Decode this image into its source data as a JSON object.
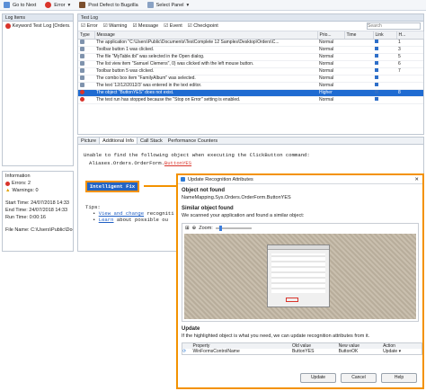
{
  "toolbar": {
    "items": [
      {
        "label": "Go to Next",
        "icon": "go-to-next-icon"
      },
      {
        "label": "Error",
        "icon": "error-icon"
      },
      {
        "label": "Post Defect to Bugzilla",
        "icon": "bugzilla-icon"
      },
      {
        "label": "Select Panel",
        "icon": "select-panel-icon"
      }
    ]
  },
  "log_items": {
    "title": "Log Items",
    "item": "Keyword Test Log [Orders..."
  },
  "test_log": {
    "title": "Test Log",
    "filters": [
      "Error",
      "Warning",
      "Message",
      "Event",
      "Checkpoint"
    ],
    "search_placeholder": "Search",
    "columns": [
      "Type",
      "Message",
      "Prio...",
      "Time",
      "Link",
      "H..."
    ],
    "rows": [
      {
        "message": "The application \"C:\\Users\\Public\\Documents\\TestComplete 12 Samples\\Desktop\\Orders\\C...",
        "prio": "Normal",
        "h": "1",
        "type": "message"
      },
      {
        "message": "Toolbar button 1 was clicked.",
        "prio": "Normal",
        "h": "3",
        "type": "message"
      },
      {
        "message": "The file \"MyTable.tbl\" was selected in the Open dialog.",
        "prio": "Normal",
        "h": "5",
        "type": "message"
      },
      {
        "message": "The list view item \"Samuel Clemens\", 0) was clicked with the left mouse button.",
        "prio": "Normal",
        "h": "6",
        "type": "message"
      },
      {
        "message": "Toolbar button 5 was clicked.",
        "prio": "Normal",
        "h": "7",
        "type": "message"
      },
      {
        "message": "The combo box item \"FamilyAlbum\" was selected.",
        "prio": "Normal",
        "h": "",
        "type": "message"
      },
      {
        "message": "The text '12/12/2012/3' was entered in the text editor.",
        "prio": "Normal",
        "h": "",
        "type": "message"
      },
      {
        "message": "The object \"ButtonYES\" does not exist.",
        "prio": "Higher",
        "h": "8",
        "type": "error"
      },
      {
        "message": "The test run has stopped because the \"Stop on Error\" setting is enabled.",
        "prio": "Normal",
        "h": "",
        "type": "error"
      }
    ]
  },
  "details": {
    "tabs": [
      "Picture",
      "Additional Info",
      "Call Stack",
      "Performance Counters"
    ],
    "line1": "Unable to find the following object when executing the ClickButton command:",
    "path_prefix": "Aliases.Orders.OrderForm.",
    "path_object": "ButtonYES",
    "intelligent_fix": "Intelligent Fix",
    "tips_label": "Tips:",
    "tip1_link": "View and change",
    "tip1_rest": "recogniti",
    "tip2_link": "Learn",
    "tip2_rest": "about possible ou"
  },
  "information": {
    "title": "Information",
    "errors": "Errors: 2",
    "warnings": "Warnings: 0",
    "start_time": "Start Time: 24/07/2018 14:33",
    "end_time": "End Time: 24/07/2018 14:33",
    "run_time": "Run Time: 0:00:16",
    "file_name": "File Name: C:\\Users\\Public\\Docume"
  },
  "dialog": {
    "title": "Update Recognition Attributes",
    "object_not_found_heading": "Object not found",
    "object_not_found_text": "NameMapping.Sys.Orders.OrderForm.ButtonYES",
    "similar_heading": "Similar object found",
    "similar_text": "We scanned your application and found a similar object:",
    "zoom_label": "Zoom:",
    "update_heading": "Update",
    "update_text": "If the highlighted object is what you need, we can update recognition attributes from it.",
    "table_columns": [
      "Property",
      "Old value",
      "New value",
      "Action"
    ],
    "table_row": {
      "property": "WinFormsControlName",
      "old": "ButtonYES",
      "new": "ButtonOK",
      "action": "Update"
    },
    "buttons": [
      "Update",
      "Cancel",
      "Help"
    ]
  },
  "colors": {
    "accent": "#1f6bd1",
    "callout_border": "#f39200",
    "error": "#d9342b"
  }
}
